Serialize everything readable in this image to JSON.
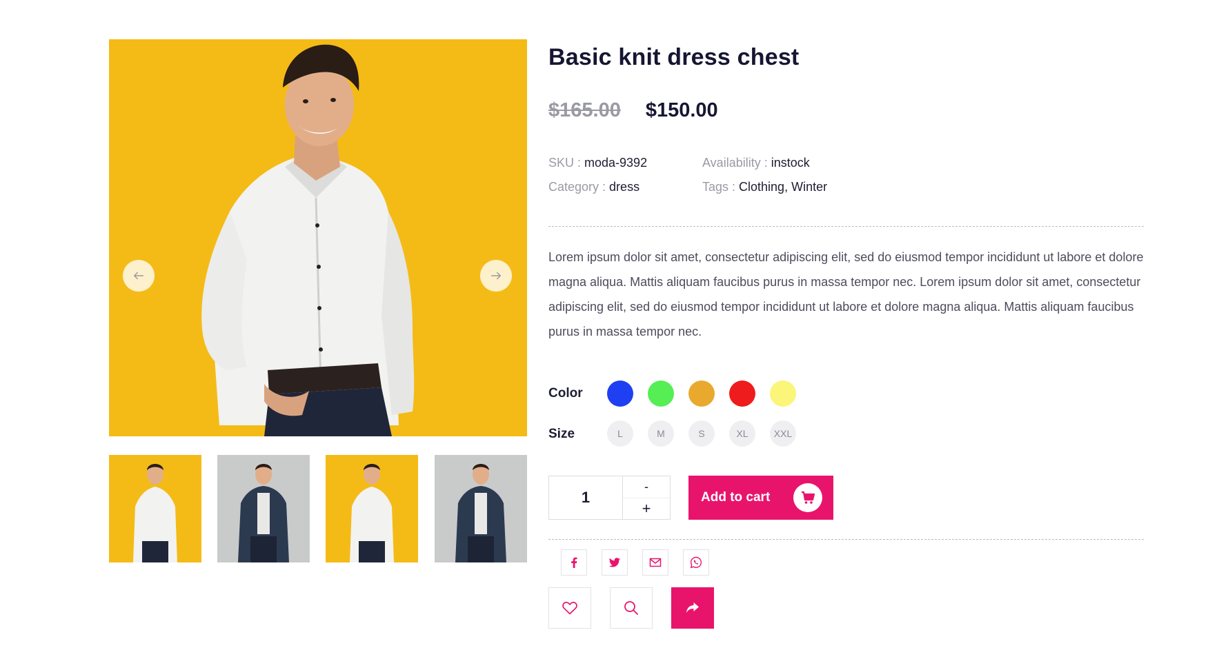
{
  "product": {
    "title": "Basic knit dress chest",
    "old_price": "$165.00",
    "new_price": "$150.00",
    "meta": {
      "sku_label": "SKU : ",
      "sku_value": "moda-9392",
      "availability_label": "Availability : ",
      "availability_value": "instock",
      "category_label": "Category : ",
      "category_value": "dress",
      "tags_label": "Tags : ",
      "tags": [
        "Clothing",
        "Winter"
      ],
      "tags_separator": ", "
    },
    "description": "Lorem ipsum dolor sit amet, consectetur adipiscing elit, sed do eiusmod tempor incididunt ut labore et dolore magna aliqua. Mattis aliquam faucibus purus in massa tempor nec. Lorem ipsum dolor sit amet, consectetur adipiscing elit, sed do eiusmod tempor incididunt ut labore et dolore magna aliqua. Mattis aliquam faucibus purus in massa tempor nec."
  },
  "options": {
    "color_label": "Color",
    "colors": [
      "#1e3ff2",
      "#55ee55",
      "#e9a92f",
      "#ee1c1c",
      "#fbf57a"
    ],
    "size_label": "Size",
    "sizes": [
      "L",
      "M",
      "S",
      "XL",
      "XXL"
    ]
  },
  "cart": {
    "quantity": "1",
    "minus_label": "-",
    "plus_label": "+",
    "add_to_cart_label": "Add to cart"
  },
  "gallery": {
    "prev_icon": "arrow-left-icon",
    "next_icon": "arrow-right-icon",
    "thumbnails": [
      "white-shirt-yellow",
      "denim-jacket-grey",
      "white-shirt-yellow",
      "denim-jacket-grey"
    ]
  },
  "share": [
    "facebook-icon",
    "twitter-icon",
    "email-icon",
    "whatsapp-icon"
  ],
  "actions": [
    "heart-icon",
    "search-icon",
    "share-icon"
  ],
  "colors": {
    "accent": "#e8146c",
    "gallery_background": "#f4bb17",
    "title": "#161633"
  }
}
